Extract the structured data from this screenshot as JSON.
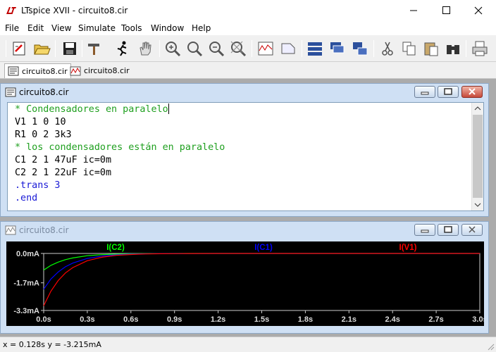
{
  "window": {
    "title": "LTspice XVII - circuito8.cir"
  },
  "menu": [
    "File",
    "Edit",
    "View",
    "Simulate",
    "Tools",
    "Window",
    "Help"
  ],
  "tabs": [
    {
      "label": "circuito8.cir",
      "icon": "netlist-icon"
    },
    {
      "label": "circuito8.cir",
      "icon": "waveform-icon"
    }
  ],
  "netlist_window": {
    "title": "circuito8.cir",
    "lines": [
      {
        "text": "* Condensadores en paralelo",
        "kind": "comment"
      },
      {
        "text": "V1 1 0 10",
        "kind": "code"
      },
      {
        "text": "R1 0 2 3k3",
        "kind": "code"
      },
      {
        "text": "* los condensadores están en paralelo",
        "kind": "comment"
      },
      {
        "text": "C1 2 1 47uF ic=0m",
        "kind": "code"
      },
      {
        "text": "C2 2 1 22uF ic=0m",
        "kind": "code"
      },
      {
        "text": ".trans 3",
        "kind": "directive"
      },
      {
        "text": ".end",
        "kind": "directive"
      }
    ]
  },
  "plot_window": {
    "title": "circuito8.cir"
  },
  "chart_data": {
    "type": "line",
    "x": [
      0,
      0.05,
      0.1,
      0.15,
      0.2,
      0.3,
      0.4,
      0.5,
      0.6,
      0.7,
      0.8,
      1.0,
      1.2,
      1.5,
      2.0,
      2.5,
      3.0
    ],
    "series": [
      {
        "name": "I(C2)",
        "color": "#00ff00",
        "values": [
          -0.96,
          -0.69,
          -0.5,
          -0.36,
          -0.26,
          -0.13,
          -0.07,
          -0.04,
          -0.02,
          -0.01,
          -0.005,
          -0.001,
          0,
          0,
          0,
          0,
          0
        ]
      },
      {
        "name": "I(C1)",
        "color": "#0000ff",
        "values": [
          -2.07,
          -1.48,
          -1.07,
          -0.77,
          -0.56,
          -0.29,
          -0.15,
          -0.08,
          -0.04,
          -0.02,
          -0.01,
          -0.003,
          0,
          0,
          0,
          0,
          0
        ]
      },
      {
        "name": "I(V1)",
        "color": "#ff0000",
        "values": [
          -3.03,
          -2.18,
          -1.57,
          -1.13,
          -0.82,
          -0.42,
          -0.22,
          -0.11,
          -0.06,
          -0.03,
          -0.015,
          -0.004,
          0,
          0,
          0,
          0,
          0
        ]
      }
    ],
    "xlim": [
      0,
      3.0
    ],
    "ylim": [
      -3.3,
      0
    ],
    "x_ticks": [
      "0.0s",
      "0.3s",
      "0.6s",
      "0.9s",
      "1.2s",
      "1.5s",
      "1.8s",
      "2.1s",
      "2.4s",
      "2.7s",
      "3.0s"
    ],
    "y_ticks": [
      "0.0mA",
      "-1.7mA",
      "-3.3mA"
    ],
    "y_tick_values": [
      0,
      -1.7,
      -3.3
    ],
    "grid": false,
    "legend": "top"
  },
  "status": {
    "text": "x = 0.128s   y = -3.215mA"
  }
}
